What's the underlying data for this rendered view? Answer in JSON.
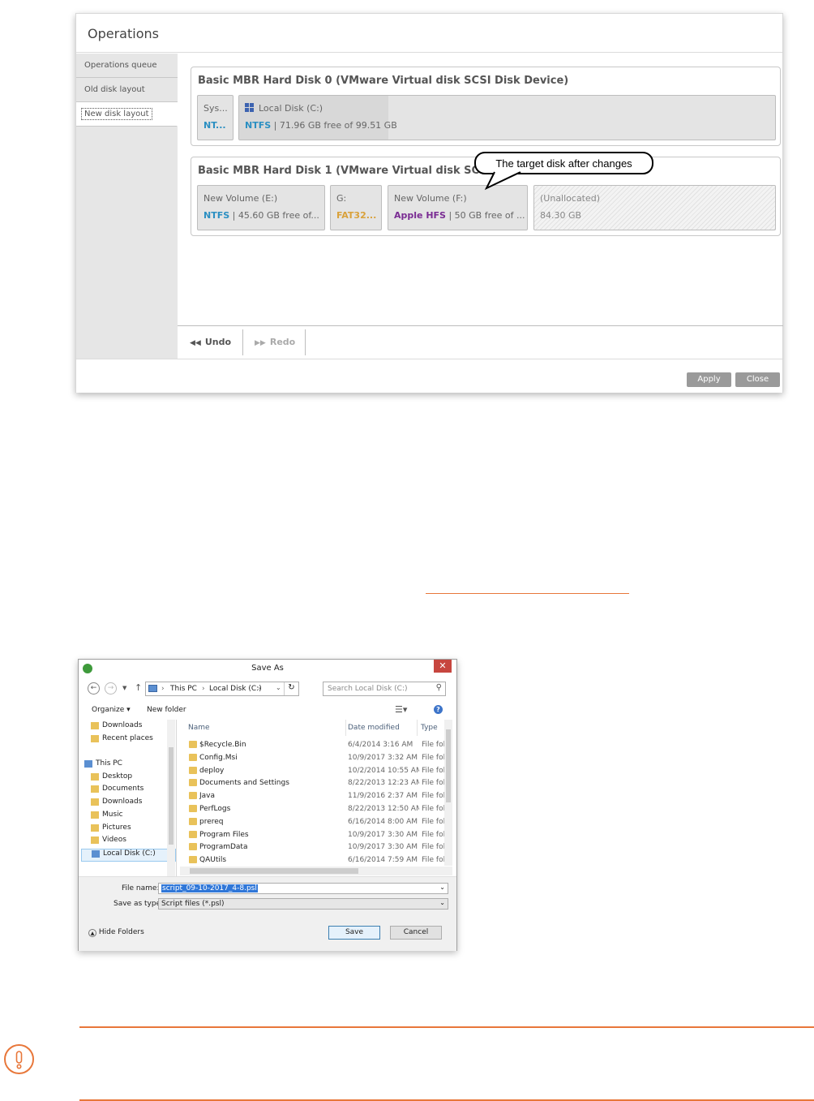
{
  "operations": {
    "title": "Operations",
    "sidebar": [
      {
        "label": "Operations queue"
      },
      {
        "label": "Old disk layout"
      },
      {
        "label": "New disk layout"
      }
    ],
    "disk0": {
      "title": "Basic MBR Hard Disk 0 (VMware Virtual disk SCSI Disk Device)",
      "partitions": [
        {
          "name": "Sys...",
          "fs": "NT...",
          "detail": ""
        },
        {
          "name": "Local Disk (C:)",
          "fs": "NTFS",
          "detail": " | 71.96 GB free of 99.51 GB"
        }
      ]
    },
    "disk1": {
      "title": "Basic MBR Hard Disk 1 (VMware Virtual disk SCSI",
      "partitions": [
        {
          "name": "New Volume (E:)",
          "fs": "NTFS",
          "detail": " | 45.60 GB free of..."
        },
        {
          "name": "G:",
          "fs": "FAT32...",
          "detail": ""
        },
        {
          "name": "New Volume (F:)",
          "fs": "Apple HFS",
          "detail": " | 50 GB free of ..."
        },
        {
          "name": "(Unallocated)",
          "fs": "",
          "detail": "84.30 GB"
        }
      ]
    },
    "callout": "The target disk after changes",
    "undo_label": "Undo",
    "redo_label": "Redo",
    "apply_label": "Apply",
    "close_label": "Close",
    "colors": {
      "ntfs": "#2b8fc2",
      "fat32": "#d9a13a",
      "hfs": "#7a2c93",
      "accent": "#e8773a"
    }
  },
  "saveas": {
    "title": "Save As",
    "close_glyph": "✕",
    "breadcrumb": [
      "This PC",
      "Local Disk (C:)"
    ],
    "search_placeholder": "Search Local Disk (C:)",
    "organize_label": "Organize ▾",
    "new_folder_label": "New folder",
    "nav_tree": [
      {
        "label": "Downloads",
        "icon": "downloads-folder-icon"
      },
      {
        "label": "Recent places",
        "icon": "recent-places-icon"
      },
      {
        "label": "",
        "icon": ""
      },
      {
        "label": "This PC",
        "icon": "computer-icon"
      },
      {
        "label": "Desktop",
        "icon": "desktop-folder-icon"
      },
      {
        "label": "Documents",
        "icon": "documents-folder-icon"
      },
      {
        "label": "Downloads",
        "icon": "downloads-folder-icon"
      },
      {
        "label": "Music",
        "icon": "music-folder-icon"
      },
      {
        "label": "Pictures",
        "icon": "pictures-folder-icon"
      },
      {
        "label": "Videos",
        "icon": "videos-folder-icon"
      },
      {
        "label": "Local Disk (C:)",
        "icon": "drive-icon"
      }
    ],
    "columns": [
      "Name",
      "Date modified",
      "Type"
    ],
    "files": [
      {
        "name": "$Recycle.Bin",
        "date": "6/4/2014 3:16 AM",
        "type": "File fol"
      },
      {
        "name": "Config.Msi",
        "date": "10/9/2017 3:32 AM",
        "type": "File fol"
      },
      {
        "name": "deploy",
        "date": "10/2/2014 10:55 AM",
        "type": "File fol"
      },
      {
        "name": "Documents and Settings",
        "date": "8/22/2013 12:23 AM",
        "type": "File fol"
      },
      {
        "name": "Java",
        "date": "11/9/2016 2:37 AM",
        "type": "File fol"
      },
      {
        "name": "PerfLogs",
        "date": "8/22/2013 12:50 AM",
        "type": "File fol"
      },
      {
        "name": "prereq",
        "date": "6/16/2014 8:00 AM",
        "type": "File fol"
      },
      {
        "name": "Program Files",
        "date": "10/9/2017 3:30 AM",
        "type": "File fol"
      },
      {
        "name": "ProgramData",
        "date": "10/9/2017 3:30 AM",
        "type": "File fol"
      },
      {
        "name": "QAUtils",
        "date": "6/16/2014 7:59 AM",
        "type": "File fol"
      }
    ],
    "file_name_label": "File name:",
    "file_name_value": "script_09-10-2017_4-8.psl",
    "save_type_label": "Save as type:",
    "save_type_value": "Script files (*.psl)",
    "hide_folders_label": "Hide Folders",
    "save_label": "Save",
    "cancel_label": "Cancel"
  }
}
